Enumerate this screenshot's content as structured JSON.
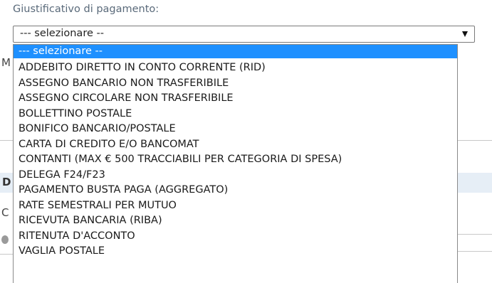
{
  "field": {
    "label": "Giustificativo di pagamento:",
    "selected_value": "--- selezionare --"
  },
  "background_fragments": {
    "f1": "M",
    "f2": "D",
    "f3": "C"
  },
  "colors": {
    "selected_option_bg": "#1e90ff",
    "selected_option_text": "#ffffff",
    "label_text": "#5a6a7a"
  },
  "dropdown": {
    "options": [
      "--- selezionare --",
      "ADDEBITO DIRETTO IN CONTO CORRENTE (RID)",
      "ASSEGNO BANCARIO NON TRASFERIBILE",
      "ASSEGNO CIRCOLARE NON TRASFERIBILE",
      "BOLLETTINO POSTALE",
      "BONIFICO BANCARIO/POSTALE",
      "CARTA DI CREDITO E/O BANCOMAT",
      "CONTANTI (MAX € 500 TRACCIABILI PER CATEGORIA DI SPESA)",
      "DELEGA F24/F23",
      "PAGAMENTO BUSTA PAGA (AGGREGATO)",
      "RATE SEMESTRALI PER MUTUO",
      "RICEVUTA BANCARIA (RIBA)",
      "RITENUTA D'ACCONTO",
      "VAGLIA POSTALE"
    ],
    "selected_index": 0
  }
}
